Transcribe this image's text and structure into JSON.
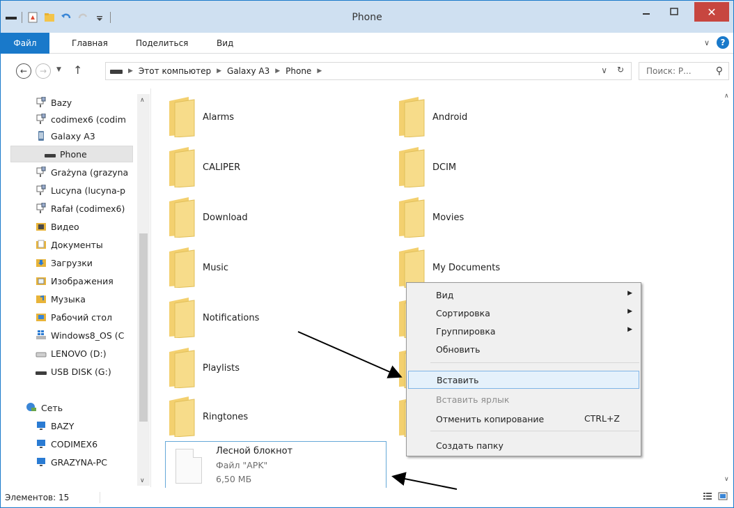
{
  "window": {
    "title": "Phone"
  },
  "ribbon": {
    "file": "Файл",
    "home": "Главная",
    "share": "Поделиться",
    "view": "Вид"
  },
  "address": {
    "breadcrumbs": [
      "Этот компьютер",
      "Galaxy A3",
      "Phone"
    ],
    "search_placeholder": "Поиск: Р..."
  },
  "nav": {
    "items": [
      {
        "label": "Bazy",
        "icon": "network-drive-icon"
      },
      {
        "label": "codimex6 (codim",
        "icon": "network-drive-icon"
      },
      {
        "label": "Galaxy A3",
        "icon": "phone-icon"
      },
      {
        "label": "Phone",
        "icon": "storage-icon"
      },
      {
        "label": "Grażyna (grazyna",
        "icon": "network-drive-icon"
      },
      {
        "label": "Lucyna (lucyna-p",
        "icon": "network-drive-icon"
      },
      {
        "label": "Rafał (codimex6)",
        "icon": "network-drive-icon"
      },
      {
        "label": "Видео",
        "icon": "video-folder-icon"
      },
      {
        "label": "Документы",
        "icon": "documents-folder-icon"
      },
      {
        "label": "Загрузки",
        "icon": "downloads-folder-icon"
      },
      {
        "label": "Изображения",
        "icon": "pictures-folder-icon"
      },
      {
        "label": "Музыка",
        "icon": "music-folder-icon"
      },
      {
        "label": "Рабочий стол",
        "icon": "desktop-folder-icon"
      },
      {
        "label": "Windows8_OS (C",
        "icon": "windows-drive-icon"
      },
      {
        "label": "LENOVO (D:)",
        "icon": "drive-icon"
      },
      {
        "label": "USB DISK (G:)",
        "icon": "usb-drive-icon"
      },
      {
        "label": "Сеть",
        "icon": "network-icon"
      },
      {
        "label": "BAZY",
        "icon": "computer-icon"
      },
      {
        "label": "CODIMEX6",
        "icon": "computer-icon"
      },
      {
        "label": "GRAZYNA-PC",
        "icon": "computer-icon"
      }
    ]
  },
  "content": {
    "folders": [
      "Alarms",
      "Android",
      "CALIPER",
      "DCIM",
      "Download",
      "Movies",
      "Music",
      "My Documents",
      "Notifications",
      "Playlists",
      "Ringtones"
    ],
    "file": {
      "name": "Лесной блокнот",
      "type": "Файл \"APK\"",
      "size": "6,50 МБ"
    }
  },
  "context_menu": {
    "view": "Вид",
    "sort": "Сортировка",
    "group": "Группировка",
    "refresh": "Обновить",
    "paste": "Вставить",
    "paste_shortcut": "Вставить ярлык",
    "undo_copy": "Отменить копирование",
    "undo_copy_key": "CTRL+Z",
    "new_folder": "Создать папку"
  },
  "status": {
    "items": "Элементов: 15"
  },
  "colors": {
    "accent": "#1979ca",
    "close": "#c7463f",
    "folder": "#f3d06f"
  }
}
